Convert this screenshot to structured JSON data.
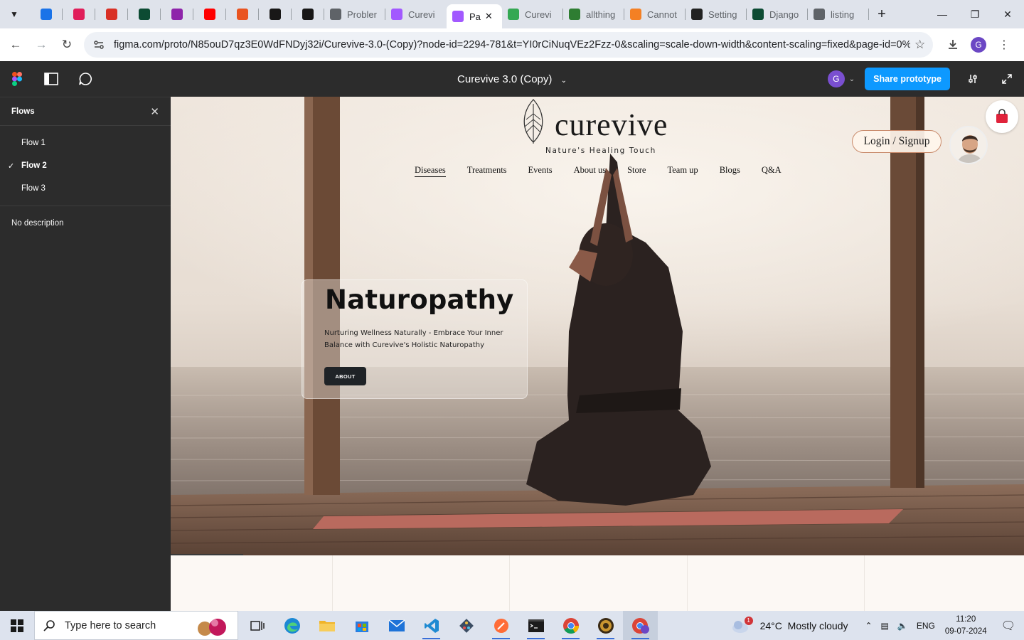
{
  "browser": {
    "tabs": [
      {
        "title": "",
        "icon": "drive-sync-icon",
        "color": "#1a73e8",
        "pinned": true
      },
      {
        "title": "",
        "icon": "slack-icon",
        "color": "#e01e5a",
        "pinned": true
      },
      {
        "title": "",
        "icon": "gmail-icon",
        "color": "#d93025",
        "pinned": true
      },
      {
        "title": "",
        "icon": "django-icon",
        "color": "#0c4b33",
        "pinned": true
      },
      {
        "title": "",
        "icon": "info-icon",
        "color": "#8e24aa",
        "pinned": true
      },
      {
        "title": "",
        "icon": "youtube-icon",
        "color": "#ff0000",
        "pinned": true
      },
      {
        "title": "",
        "icon": "ubuntu-icon",
        "color": "#e95420",
        "pinned": true
      },
      {
        "title": "",
        "icon": "github-icon",
        "color": "#181717",
        "pinned": true
      },
      {
        "title": "",
        "icon": "github-icon",
        "color": "#181717",
        "pinned": true
      },
      {
        "title": "Probler",
        "icon": "globe-icon",
        "color": "#5f6368",
        "pinned": false
      },
      {
        "title": "Curevi",
        "icon": "figma-icon",
        "color": "#a259ff",
        "pinned": false
      },
      {
        "title": "Pa",
        "icon": "figma-icon",
        "color": "#a259ff",
        "pinned": false,
        "active": true
      },
      {
        "title": "Curevi",
        "icon": "google-drive-icon",
        "color": "#34a853",
        "pinned": false
      },
      {
        "title": "allthing",
        "icon": "atd-icon",
        "color": "#2e7d32",
        "pinned": false
      },
      {
        "title": "Cannot",
        "icon": "stackoverflow-icon",
        "color": "#f48024",
        "pinned": false
      },
      {
        "title": "Setting",
        "icon": "openai-icon",
        "color": "#222222",
        "pinned": false
      },
      {
        "title": "Django",
        "icon": "django-icon",
        "color": "#0c4b33",
        "pinned": false
      },
      {
        "title": "listing",
        "icon": "globe-icon",
        "color": "#5f6368",
        "pinned": false
      }
    ],
    "url": "figma.com/proto/N85ouD7qz3E0WdFNDyj32i/Curevive-3.0-(Copy)?node-id=2294-781&t=YI0rCiNuqVEz2Fzz-0&scaling=scale-down-width&content-scaling=fixed&page-id=0%3A...",
    "profile_initial": "G"
  },
  "figma": {
    "file_title": "Curevive 3.0 (Copy)",
    "user_initial": "G",
    "share_label": "Share prototype"
  },
  "sidebar": {
    "heading": "Flows",
    "flows": [
      {
        "label": "Flow 1",
        "selected": false
      },
      {
        "label": "Flow 2",
        "selected": true
      },
      {
        "label": "Flow 3",
        "selected": false
      }
    ],
    "description": "No description"
  },
  "site": {
    "brand": "curevive",
    "tagline": "Nature's Healing Touch",
    "menu": [
      "Diseases",
      "Treatments",
      "Events",
      "About us",
      "Store",
      "Team up",
      "Blogs",
      "Q&A"
    ],
    "current_menu": "Diseases",
    "login_label": "Login / Signup",
    "hero_title": "Naturopathy",
    "hero_desc": "Nurturing Wellness Naturally - Embrace Your Inner Balance with Curevive's Holistic Naturopathy",
    "hero_button": "ABOUT"
  },
  "taskbar": {
    "search_placeholder": "Type here to search",
    "weather": "24°C  Mostly cloudy",
    "weather_badge": "1",
    "language": "ENG",
    "time": "11:20",
    "date": "09-07-2024"
  }
}
